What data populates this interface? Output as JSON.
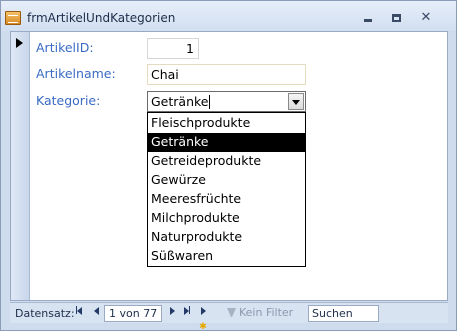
{
  "window": {
    "title": "frmArtikelUndKategorien"
  },
  "form": {
    "artikelid_label": "ArtikelID:",
    "artikelid_value": "1",
    "artikelname_label": "Artikelname:",
    "artikelname_value": "Chai",
    "kategorie_label": "Kategorie:",
    "kategorie_value": "Getränke",
    "kategorie_options": [
      "Fleischprodukte",
      "Getränke",
      "Getreideprodukte",
      "Gewürze",
      "Meeresfrüchte",
      "Milchprodukte",
      "Naturprodukte",
      "Süßwaren"
    ],
    "kategorie_selected": "Getränke"
  },
  "navigation": {
    "label": "Datensatz:",
    "record_text": "1 von 77",
    "filter_label": "Kein Filter",
    "search_placeholder": "Suchen"
  },
  "icons": [
    "app-form-icon",
    "minimize-icon",
    "maximize-icon",
    "close-icon",
    "dropdown-arrow-icon",
    "first-record-icon",
    "previous-record-icon",
    "next-record-icon",
    "last-record-icon",
    "new-record-icon",
    "filter-icon"
  ]
}
